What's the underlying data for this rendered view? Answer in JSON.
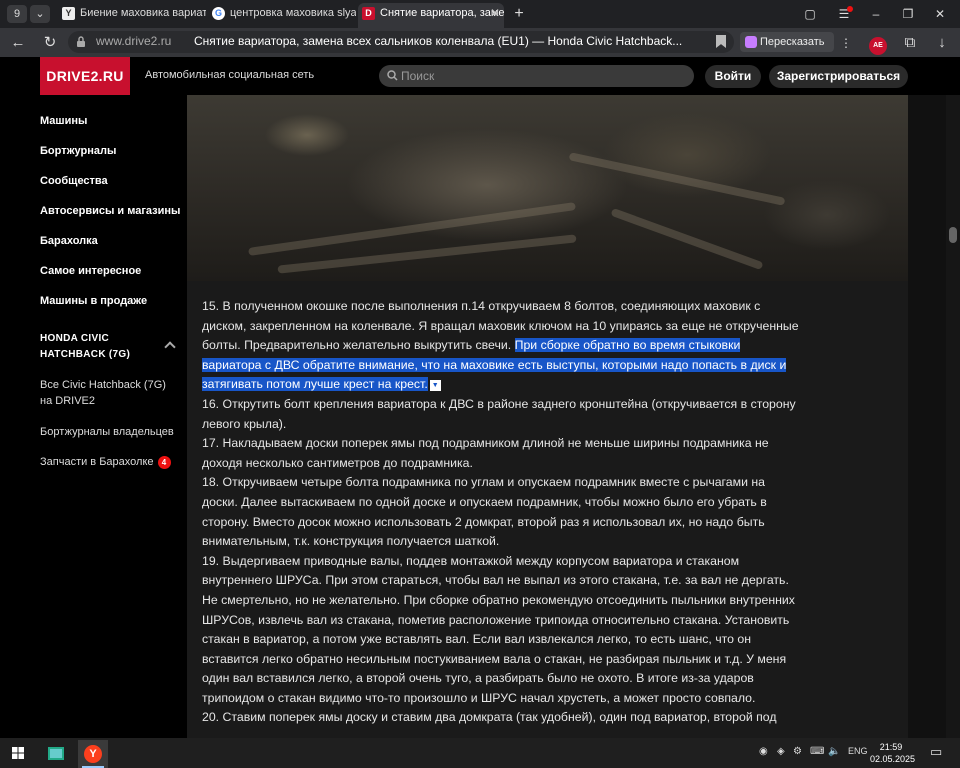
{
  "browser": {
    "tab_counter": "9",
    "tabs": [
      {
        "title": "Биение маховика вариат",
        "favicon": "Y",
        "active": false
      },
      {
        "title": "центровка маховика slya",
        "favicon": "G",
        "active": false
      },
      {
        "title": "Снятие вариатора, заме",
        "favicon": "D",
        "active": true
      }
    ],
    "url_domain": "www.drive2.ru",
    "page_title": "Снятие вариатора, замена всех сальников коленвала (EU1) — Honda Civic Hatchback...",
    "retell_label": "Пересказать",
    "profile_badge": "AE"
  },
  "site": {
    "logo": "DRIVE2.RU",
    "tagline": "Автомобильная социальная сеть",
    "search_placeholder": "Поиск",
    "login_label": "Войти",
    "register_label": "Зарегистрироваться"
  },
  "sidebar": {
    "nav": [
      "Машины",
      "Бортжурналы",
      "Сообщества",
      "Автосервисы и магазины",
      "Барахолка",
      "Самое интересное",
      "Машины в продаже"
    ],
    "section_title": "HONDA CIVIC HATCHBACK (7G)",
    "links": [
      {
        "label": "Все Civic Hatchback (7G) на DRIVE2"
      },
      {
        "label": "Бортжурналы владельцев"
      },
      {
        "label": "Запчасти в Барахолке",
        "badge": "4"
      }
    ]
  },
  "article": {
    "p15_a": "15. В полученном окошке после выполнения п.14 откручиваем 8 болтов, соединяющих маховик с диском, закрепленном на коленвале. Я вращал маховик ключом на 10 упираясь за еще не открученные болты. Предварительно желательно выкрутить свечи. ",
    "p15_hl": "При сборке обратно во время стыковки вариатора с ДВС обратите внимание, что на маховике есть выступы, которыми надо попасть в диск и затягивать потом лучше крест на крест.",
    "p16": "16. Открутить болт крепления вариатора к ДВС в районе заднего кронштейна (откручивается в сторону левого крыла).",
    "p17": "17. Накладываем доски поперек ямы под подрамником длиной не меньше ширины подрамника не доходя несколько сантиметров до подрамника.",
    "p18": "18. Откручиваем четыре болта подрамника по углам и опускаем подрамник вместе с рычагами на доски. Далее вытаскиваем по одной доске и опускаем подрамник, чтобы можно было его убрать в сторону. Вместо досок можно использовать 2 домкрат, второй раз я использовал их, но надо быть внимательным, т.к. конструкция получается шаткой.",
    "p19": "19. Выдергиваем приводные валы, поддев монтажкой между корпусом вариатора и стаканом внутреннего ШРУСа. При этом стараться, чтобы вал не выпал из этого стакана, т.е. за вал не дергать. Не смертельно, но не желательно. При сборке обратно рекомендую отсоединить пыльники внутренних ШРУСов, извлечь вал из стакана, пометив расположение трипоида относительно стакана. Установить стакан в вариатор, а потом уже вставлять вал. Если вал извлекался легко, то есть шанс, что он вставится легко обратно несильным постукиванием вала о стакан, не разбирая пыльник и т.д. У меня один вал вставился легко, а второй очень туго, а разбирать было не охото. В итоге из-за ударов трипоидом о стакан видимо что-то произошло и ШРУС начал хрустеть, а может просто совпало.",
    "p20": "20. Ставим поперек ямы доску и ставим два домкрата (так удобней), один под вариатор, второй под"
  },
  "taskbar": {
    "lang": "ENG",
    "time": "21:59",
    "date": "02.05.2025"
  }
}
